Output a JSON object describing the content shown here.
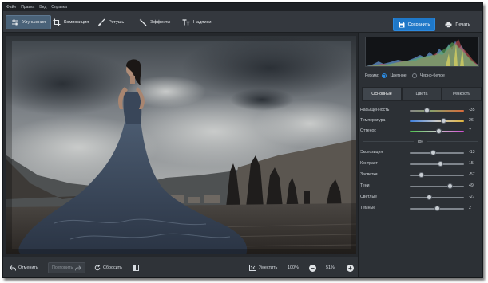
{
  "menu": [
    "Файл",
    "Правка",
    "Вид",
    "Справка"
  ],
  "toolbar": {
    "tools": [
      {
        "label": "Улучшения",
        "icon": "sliders-icon",
        "active": true
      },
      {
        "label": "Композиция",
        "icon": "crop-icon",
        "active": false
      },
      {
        "label": "Ретушь",
        "icon": "brush-icon",
        "active": false
      },
      {
        "label": "Эффекты",
        "icon": "magic-wand-icon",
        "active": false
      },
      {
        "label": "Надписи",
        "icon": "text-icon",
        "active": false
      }
    ],
    "save_label": "Сохранить",
    "print_label": "Печать"
  },
  "bottom": {
    "undo": "Отменить",
    "redo": "Повторить",
    "reset": "Сбросить",
    "fit": "Уместить",
    "zoom_actual": "100%",
    "zoom_value": "51%"
  },
  "panel": {
    "mode_label": "Режим:",
    "mode_color": "Цветное",
    "mode_bw": "Черно-белое",
    "tabs": [
      "Основные",
      "Цвета",
      "Резкость"
    ],
    "color_sliders": [
      {
        "label": "Насыщенность",
        "value": "-35",
        "level": 0.32
      },
      {
        "label": "Температура",
        "value": "26",
        "level": 0.63
      },
      {
        "label": "Оттенок",
        "value": "7",
        "level": 0.54
      }
    ],
    "tone_title": "Тон",
    "tone_sliders": [
      {
        "label": "Экспозиция",
        "value": "-13",
        "level": 0.43
      },
      {
        "label": "Контраст",
        "value": "15",
        "level": 0.57
      },
      {
        "label": "Засветки",
        "value": "-57",
        "level": 0.21
      },
      {
        "label": "Тени",
        "value": "49",
        "level": 0.74
      },
      {
        "label": "Светлые",
        "value": "-27",
        "level": 0.36
      },
      {
        "label": "Тёмные",
        "value": "2",
        "level": 0.51
      }
    ]
  },
  "colors": {
    "accent": "#1f78c8",
    "window_bg": "#2c3035",
    "toolbar_bg": "#34383e"
  }
}
